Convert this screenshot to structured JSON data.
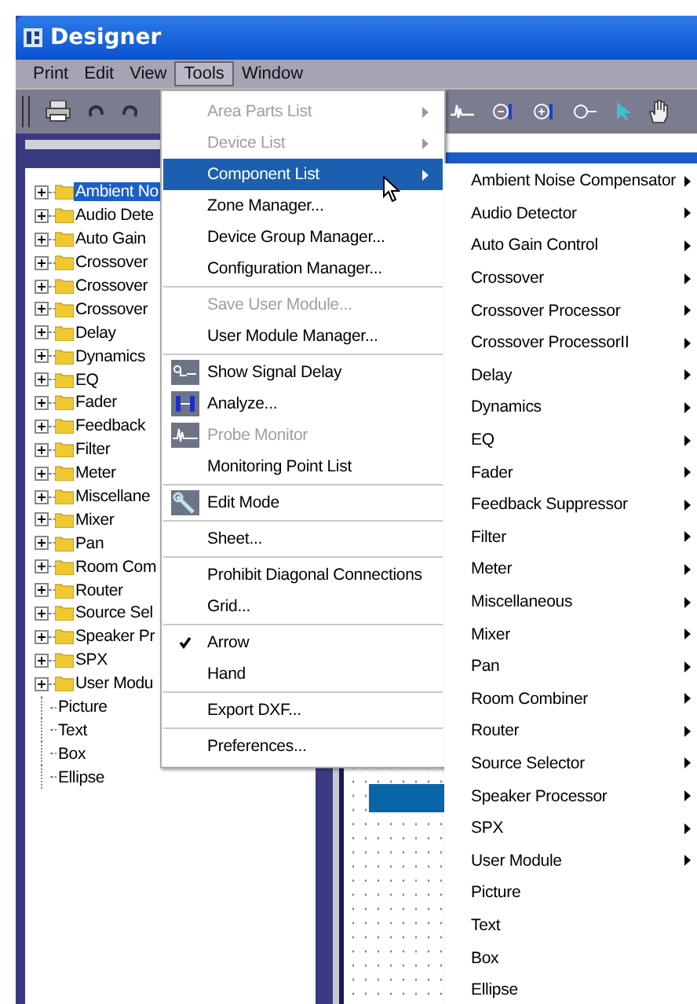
{
  "window": {
    "title": "Designer"
  },
  "menu_bar": [
    {
      "label": "Print",
      "selected": false
    },
    {
      "label": "Edit",
      "selected": false
    },
    {
      "label": "View",
      "selected": false
    },
    {
      "label": "Tools",
      "selected": true
    },
    {
      "label": "Window",
      "selected": false
    }
  ],
  "tree": {
    "items": [
      {
        "label": "Ambient No",
        "kind": "folder",
        "selected": true
      },
      {
        "label": "Audio Dete",
        "kind": "folder",
        "selected": false
      },
      {
        "label": "Auto Gain",
        "kind": "folder",
        "selected": false
      },
      {
        "label": "Crossover",
        "kind": "folder",
        "selected": false
      },
      {
        "label": "Crossover",
        "kind": "folder",
        "selected": false
      },
      {
        "label": "Crossover",
        "kind": "folder",
        "selected": false
      },
      {
        "label": "Delay",
        "kind": "folder",
        "selected": false
      },
      {
        "label": "Dynamics",
        "kind": "folder",
        "selected": false
      },
      {
        "label": "EQ",
        "kind": "folder",
        "selected": false
      },
      {
        "label": "Fader",
        "kind": "folder",
        "selected": false
      },
      {
        "label": "Feedback",
        "kind": "folder",
        "selected": false
      },
      {
        "label": "Filter",
        "kind": "folder",
        "selected": false
      },
      {
        "label": "Meter",
        "kind": "folder",
        "selected": false
      },
      {
        "label": "Miscellane",
        "kind": "folder",
        "selected": false
      },
      {
        "label": "Mixer",
        "kind": "folder",
        "selected": false
      },
      {
        "label": "Pan",
        "kind": "folder",
        "selected": false
      },
      {
        "label": "Room Com",
        "kind": "folder",
        "selected": false
      },
      {
        "label": "Router",
        "kind": "folder",
        "selected": false
      },
      {
        "label": "Source Sel",
        "kind": "folder",
        "selected": false
      },
      {
        "label": "Speaker Pr",
        "kind": "folder",
        "selected": false
      },
      {
        "label": "SPX",
        "kind": "folder",
        "selected": false
      },
      {
        "label": "User Modu",
        "kind": "folder",
        "selected": false
      },
      {
        "label": "Picture",
        "kind": "leaf",
        "selected": false
      },
      {
        "label": "Text",
        "kind": "leaf",
        "selected": false
      },
      {
        "label": "Box",
        "kind": "leaf",
        "selected": false
      },
      {
        "label": "Ellipse",
        "kind": "leaf",
        "selected": false
      }
    ]
  },
  "tools_menu": {
    "items": [
      {
        "kind": "item",
        "label": "Area Parts List",
        "disabled": true,
        "submenu": true,
        "selected": false
      },
      {
        "kind": "item",
        "label": "Device List",
        "disabled": true,
        "submenu": true,
        "selected": false
      },
      {
        "kind": "item",
        "label": "Component List",
        "disabled": false,
        "submenu": true,
        "selected": true
      },
      {
        "kind": "item",
        "label": "Zone Manager...",
        "disabled": false,
        "submenu": false,
        "selected": false
      },
      {
        "kind": "item",
        "label": "Device Group Manager...",
        "disabled": false,
        "submenu": false,
        "selected": false
      },
      {
        "kind": "item",
        "label": "Configuration Manager...",
        "disabled": false,
        "submenu": false,
        "selected": false
      },
      {
        "kind": "separator"
      },
      {
        "kind": "item",
        "label": "Save User Module...",
        "disabled": true,
        "submenu": false,
        "selected": false
      },
      {
        "kind": "item",
        "label": "User Module Manager...",
        "disabled": false,
        "submenu": false,
        "selected": false
      },
      {
        "kind": "separator"
      },
      {
        "kind": "icon_item",
        "label": "Show Signal Delay",
        "disabled": false,
        "submenu": false,
        "selected": false
      },
      {
        "kind": "icon_item",
        "label": "Analyze...",
        "disabled": false,
        "submenu": false,
        "selected": false
      },
      {
        "kind": "icon_item",
        "label": "Probe Monitor",
        "disabled": true,
        "submenu": false,
        "selected": false
      },
      {
        "kind": "item",
        "label": "Monitoring Point List",
        "disabled": false,
        "submenu": false,
        "selected": false
      },
      {
        "kind": "separator"
      },
      {
        "kind": "icon_item",
        "label": "Edit Mode",
        "disabled": false,
        "submenu": false,
        "selected": false
      },
      {
        "kind": "separator"
      },
      {
        "kind": "item",
        "label": "Sheet...",
        "disabled": false,
        "submenu": false,
        "selected": false
      },
      {
        "kind": "separator"
      },
      {
        "kind": "item",
        "label": "Prohibit Diagonal Connections",
        "disabled": false,
        "submenu": false,
        "selected": false
      },
      {
        "kind": "item",
        "label": "Grid...",
        "disabled": false,
        "submenu": false,
        "selected": false
      },
      {
        "kind": "separator"
      },
      {
        "kind": "check_item",
        "label": "Arrow",
        "disabled": false,
        "submenu": false,
        "selected": false,
        "checked": true
      },
      {
        "kind": "check_item",
        "label": "Hand",
        "disabled": false,
        "submenu": false,
        "selected": false,
        "checked": false
      },
      {
        "kind": "separator"
      },
      {
        "kind": "item",
        "label": "Export DXF...",
        "disabled": false,
        "submenu": false,
        "selected": false
      },
      {
        "kind": "separator"
      },
      {
        "kind": "item",
        "label": "Preferences...",
        "disabled": false,
        "submenu": false,
        "selected": false
      }
    ]
  },
  "component_submenu": {
    "items": [
      {
        "label": "Ambient Noise Compensator",
        "submenu": true
      },
      {
        "label": "Audio Detector",
        "submenu": true
      },
      {
        "label": "Auto Gain Control",
        "submenu": true
      },
      {
        "label": "Crossover",
        "submenu": true
      },
      {
        "label": "Crossover Processor",
        "submenu": true
      },
      {
        "label": "Crossover ProcessorII",
        "submenu": true
      },
      {
        "label": "Delay",
        "submenu": true
      },
      {
        "label": "Dynamics",
        "submenu": true
      },
      {
        "label": "EQ",
        "submenu": true
      },
      {
        "label": "Fader",
        "submenu": true
      },
      {
        "label": "Feedback Suppressor",
        "submenu": true
      },
      {
        "label": "Filter",
        "submenu": true
      },
      {
        "label": "Meter",
        "submenu": true
      },
      {
        "label": "Miscellaneous",
        "submenu": true
      },
      {
        "label": "Mixer",
        "submenu": true
      },
      {
        "label": "Pan",
        "submenu": true
      },
      {
        "label": "Room Combiner",
        "submenu": true
      },
      {
        "label": "Router",
        "submenu": true
      },
      {
        "label": "Source Selector",
        "submenu": true
      },
      {
        "label": "Speaker Processor",
        "submenu": true
      },
      {
        "label": "SPX",
        "submenu": true
      },
      {
        "label": "User Module",
        "submenu": true
      },
      {
        "label": "Picture",
        "submenu": false
      },
      {
        "label": "Text",
        "submenu": false
      },
      {
        "label": "Box",
        "submenu": false
      },
      {
        "label": "Ellipse",
        "submenu": false
      }
    ]
  }
}
